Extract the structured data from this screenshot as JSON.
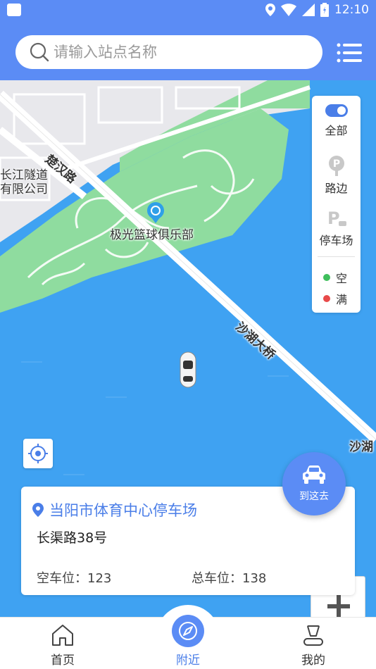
{
  "status_bar": {
    "time": "12:10"
  },
  "search": {
    "placeholder": "请输入站点名称",
    "value": ""
  },
  "map": {
    "labels": {
      "road_1": "楚汉路",
      "poi_1_line1": "长江隧道",
      "poi_1_line2": "有限公司",
      "poi_2": "极光篮球俱乐部",
      "bridge": "沙湖大桥",
      "edge": "沙湖"
    }
  },
  "filter": {
    "all": "全部",
    "roadside": "路边",
    "parking_lot": "停车场",
    "legend_empty": "空",
    "legend_full": "满"
  },
  "colors": {
    "accent": "#5b8cf5",
    "legend_empty": "#3fbf5c",
    "legend_full": "#e84a4a"
  },
  "card": {
    "title": "当阳市体育中心停车场",
    "address": "长渠路38号",
    "free_label": "空车位：",
    "free_value": "123",
    "total_label": "总车位：",
    "total_value": "138"
  },
  "go_button": {
    "label": "到这去"
  },
  "nav": {
    "home": "首页",
    "nearby": "附近",
    "mine": "我的"
  }
}
